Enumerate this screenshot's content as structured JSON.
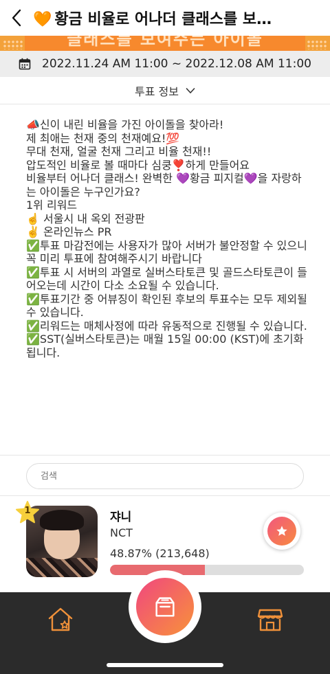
{
  "header": {
    "back_label": "<",
    "title_heart": "🧡",
    "title": "황금 비율로 어나더 클래스를 보…",
    "banner_text": "클래스를 보여주는 아이돌"
  },
  "period": {
    "text": "2022.11.24 AM 11:00 ~ 2022.12.08 AM 11:00"
  },
  "vote_info": {
    "label": "투표 정보"
  },
  "description": {
    "lines": [
      "📣신이 내린 비율을 가진 아이돌을 찾아라!",
      "",
      "제 최애는 천재 중의 천재예요!💯",
      "무대 천재, 얼굴 천재 그리고 비율 천재!!",
      "압도적인 비율로 볼 때마다 심쿵❣️하게 만들어요",
      "",
      "비율부터 어나더 클래스! 완벽한 💜황금 피지컬💜을 자랑하는 아이돌은 누구인가요?",
      "",
      "1위 리워드",
      "☝️ 서울시 내 옥외 전광판",
      "✌️ 온라인뉴스 PR",
      "",
      "✅투표 마감전에는 사용자가 많아 서버가 불안정할 수 있으니 꼭 미리 투표에 참여해주시기 바랍니다",
      "✅투표 시 서버의 과열로 실버스타토큰 및 골드스타토큰이 들어오는데 시간이 다소 소요될 수 있습니다.",
      "✅투표기간 중 어뷰징이 확인된 후보의 투표수는 모두 제외될 수 있습니다.",
      "✅리워드는 매체사정에 따라 유동적으로 진행될 수 있습니다.",
      "✅SST(실버스타토큰)는 매월 15일 00:00 (KST)에 초기화 됩니다."
    ]
  },
  "search": {
    "placeholder": "검색"
  },
  "candidates": [
    {
      "rank": "1",
      "name": "쟈니",
      "group": "NCT",
      "percent_text": "48.87% (213,648)",
      "percent": 48.87
    }
  ],
  "colors": {
    "accent": "#f2577e",
    "bar_fill": "#e86a6f",
    "nav_bg": "#2b2b2b",
    "nav_icon": "#f0913a"
  },
  "icons": {
    "back": "chevron-left-icon",
    "calendar": "calendar-icon",
    "dropdown": "chevron-down-icon",
    "vote": "star-icon",
    "home": "home-star-icon",
    "center": "ballot-box-icon",
    "store": "store-icon"
  }
}
